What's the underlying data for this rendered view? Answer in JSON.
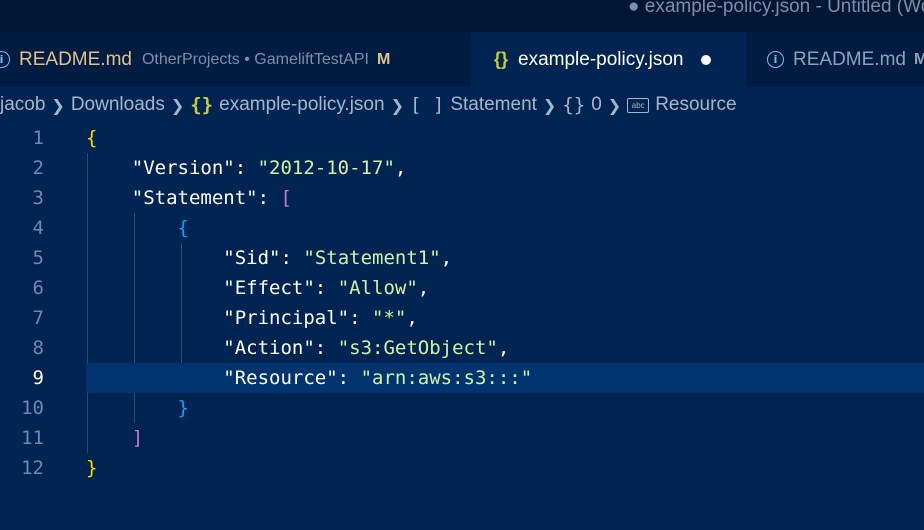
{
  "window": {
    "title": "● example-policy.json - Untitled (Workspace)"
  },
  "tabs": [
    {
      "label": "README.md",
      "path": "OtherProjects • GameliftTestAPI",
      "status": "M",
      "icon": "info-icon"
    },
    {
      "label": "example-policy.json",
      "icon": "braces-icon",
      "dirty": true
    },
    {
      "label": "README.md",
      "path": "",
      "status": "M",
      "icon": "info-icon"
    }
  ],
  "breadcrumb": {
    "items": [
      "jacob",
      "Downloads",
      "example-policy.json",
      "Statement",
      "0",
      "Resource"
    ],
    "icons": [
      "",
      "",
      "{}",
      "[ ]",
      "{}",
      "abc"
    ]
  },
  "editor": {
    "line_numbers": [
      "1",
      "2",
      "3",
      "4",
      "5",
      "6",
      "7",
      "8",
      "9",
      "10",
      "11",
      "12"
    ],
    "current_line": 9,
    "lines": [
      [
        {
          "t": "{",
          "c": "b1"
        }
      ],
      [
        {
          "t": "    "
        },
        {
          "t": "\"Version\"",
          "c": "k"
        },
        {
          "t": ": ",
          "c": "p"
        },
        {
          "t": "\"2012-10-17\"",
          "c": "s"
        },
        {
          "t": ",",
          "c": "p"
        }
      ],
      [
        {
          "t": "    "
        },
        {
          "t": "\"Statement\"",
          "c": "k"
        },
        {
          "t": ": ",
          "c": "p"
        },
        {
          "t": "[",
          "c": "b2"
        }
      ],
      [
        {
          "t": "        "
        },
        {
          "t": "{",
          "c": "b3"
        }
      ],
      [
        {
          "t": "            "
        },
        {
          "t": "\"Sid\"",
          "c": "k"
        },
        {
          "t": ": ",
          "c": "p"
        },
        {
          "t": "\"Statement1\"",
          "c": "s"
        },
        {
          "t": ",",
          "c": "p"
        }
      ],
      [
        {
          "t": "            "
        },
        {
          "t": "\"Effect\"",
          "c": "k"
        },
        {
          "t": ": ",
          "c": "p"
        },
        {
          "t": "\"Allow\"",
          "c": "s"
        },
        {
          "t": ",",
          "c": "p"
        }
      ],
      [
        {
          "t": "            "
        },
        {
          "t": "\"Principal\"",
          "c": "k"
        },
        {
          "t": ": ",
          "c": "p"
        },
        {
          "t": "\"*\"",
          "c": "s"
        },
        {
          "t": ",",
          "c": "p"
        }
      ],
      [
        {
          "t": "            "
        },
        {
          "t": "\"Action\"",
          "c": "k"
        },
        {
          "t": ": ",
          "c": "p"
        },
        {
          "t": "\"s3:GetObject\"",
          "c": "s"
        },
        {
          "t": ",",
          "c": "p"
        }
      ],
      [
        {
          "t": "            "
        },
        {
          "t": "\"Resource\"",
          "c": "k"
        },
        {
          "t": ": ",
          "c": "p"
        },
        {
          "t": "\"arn:aws:s3:::\"",
          "c": "s"
        }
      ],
      [
        {
          "t": "        "
        },
        {
          "t": "}",
          "c": "b3"
        }
      ],
      [
        {
          "t": "    "
        },
        {
          "t": "]",
          "c": "b2"
        }
      ],
      [
        {
          "t": "}",
          "c": "b1"
        }
      ]
    ]
  },
  "colors": {
    "editor_bg": "#002451",
    "string": "#d1f1a9",
    "bracket_level1": "#ffd700",
    "bracket_level2": "#da70d6",
    "bracket_level3": "#179fff",
    "modified": "#e2c08d"
  }
}
